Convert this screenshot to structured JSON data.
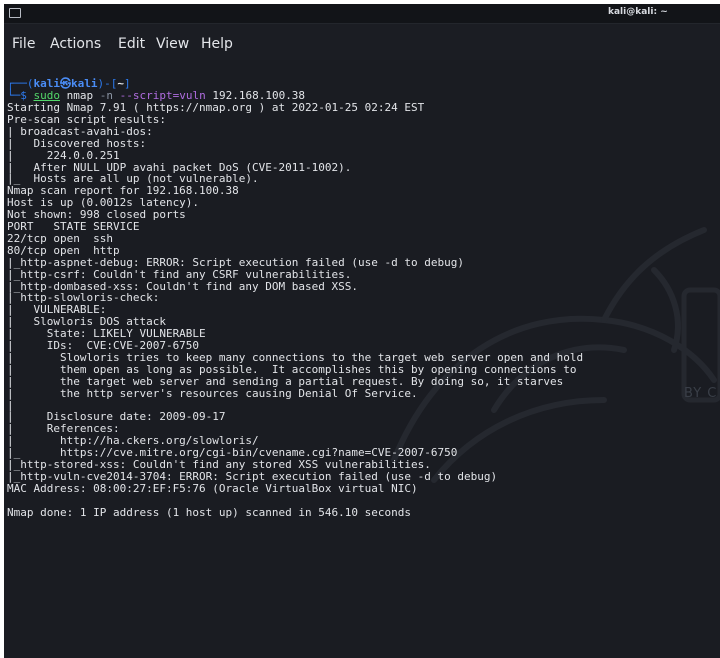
{
  "window": {
    "title": "kali@kali: ~"
  },
  "menu": {
    "file": "File",
    "actions": "Actions",
    "edit": "Edit",
    "view": "View",
    "help": "Help"
  },
  "prompt": {
    "corner_top": "┌──",
    "open": "(",
    "user_host": "kali㉿kali",
    "close": ")-[",
    "path": "~",
    "end": "]",
    "corner_bottom": "└─",
    "dollar": "$ ",
    "sudo": "sudo",
    "nmap": " nmap ",
    "flag_n": "-n ",
    "flag_script": "--script=vuln",
    "target": " 192.168.100.38"
  },
  "output": [
    "Starting Nmap 7.91 ( https://nmap.org ) at 2022-01-25 02:24 EST",
    "Pre-scan script results:",
    "| broadcast-avahi-dos:",
    "|   Discovered hosts:",
    "|     224.0.0.251",
    "|   After NULL UDP avahi packet DoS (CVE-2011-1002).",
    "|_  Hosts are all up (not vulnerable).",
    "Nmap scan report for 192.168.100.38",
    "Host is up (0.0012s latency).",
    "Not shown: 998 closed ports",
    "PORT   STATE SERVICE",
    "22/tcp open  ssh",
    "80/tcp open  http",
    "|_http-aspnet-debug: ERROR: Script execution failed (use -d to debug)",
    "|_http-csrf: Couldn't find any CSRF vulnerabilities.",
    "|_http-dombased-xss: Couldn't find any DOM based XSS.",
    "| http-slowloris-check:",
    "|   VULNERABLE:",
    "|   Slowloris DOS attack",
    "|     State: LIKELY VULNERABLE",
    "|     IDs:  CVE:CVE-2007-6750",
    "|       Slowloris tries to keep many connections to the target web server open and hold",
    "|       them open as long as possible.  It accomplishes this by opening connections to",
    "|       the target web server and sending a partial request. By doing so, it starves",
    "|       the http server's resources causing Denial Of Service.",
    "|",
    "|     Disclosure date: 2009-09-17",
    "|     References:",
    "|       http://ha.ckers.org/slowloris/",
    "|_      https://cve.mitre.org/cgi-bin/cvename.cgi?name=CVE-2007-6750",
    "|_http-stored-xss: Couldn't find any stored XSS vulnerabilities.",
    "|_http-vuln-cve2014-3704: ERROR: Script execution failed (use -d to debug)",
    "MAC Address: 08:00:27:EF:F5:76 (Oracle VirtualBox virtual NIC)",
    "",
    "Nmap done: 1 IP address (1 host up) scanned in 546.10 seconds"
  ],
  "watermark": {
    "text": "BY C"
  },
  "colors": {
    "terminal_bg": "#1a1c22",
    "prompt_blue": "#2d7bf0",
    "sudo_green": "#53d86a",
    "script_purple": "#b06de0"
  }
}
